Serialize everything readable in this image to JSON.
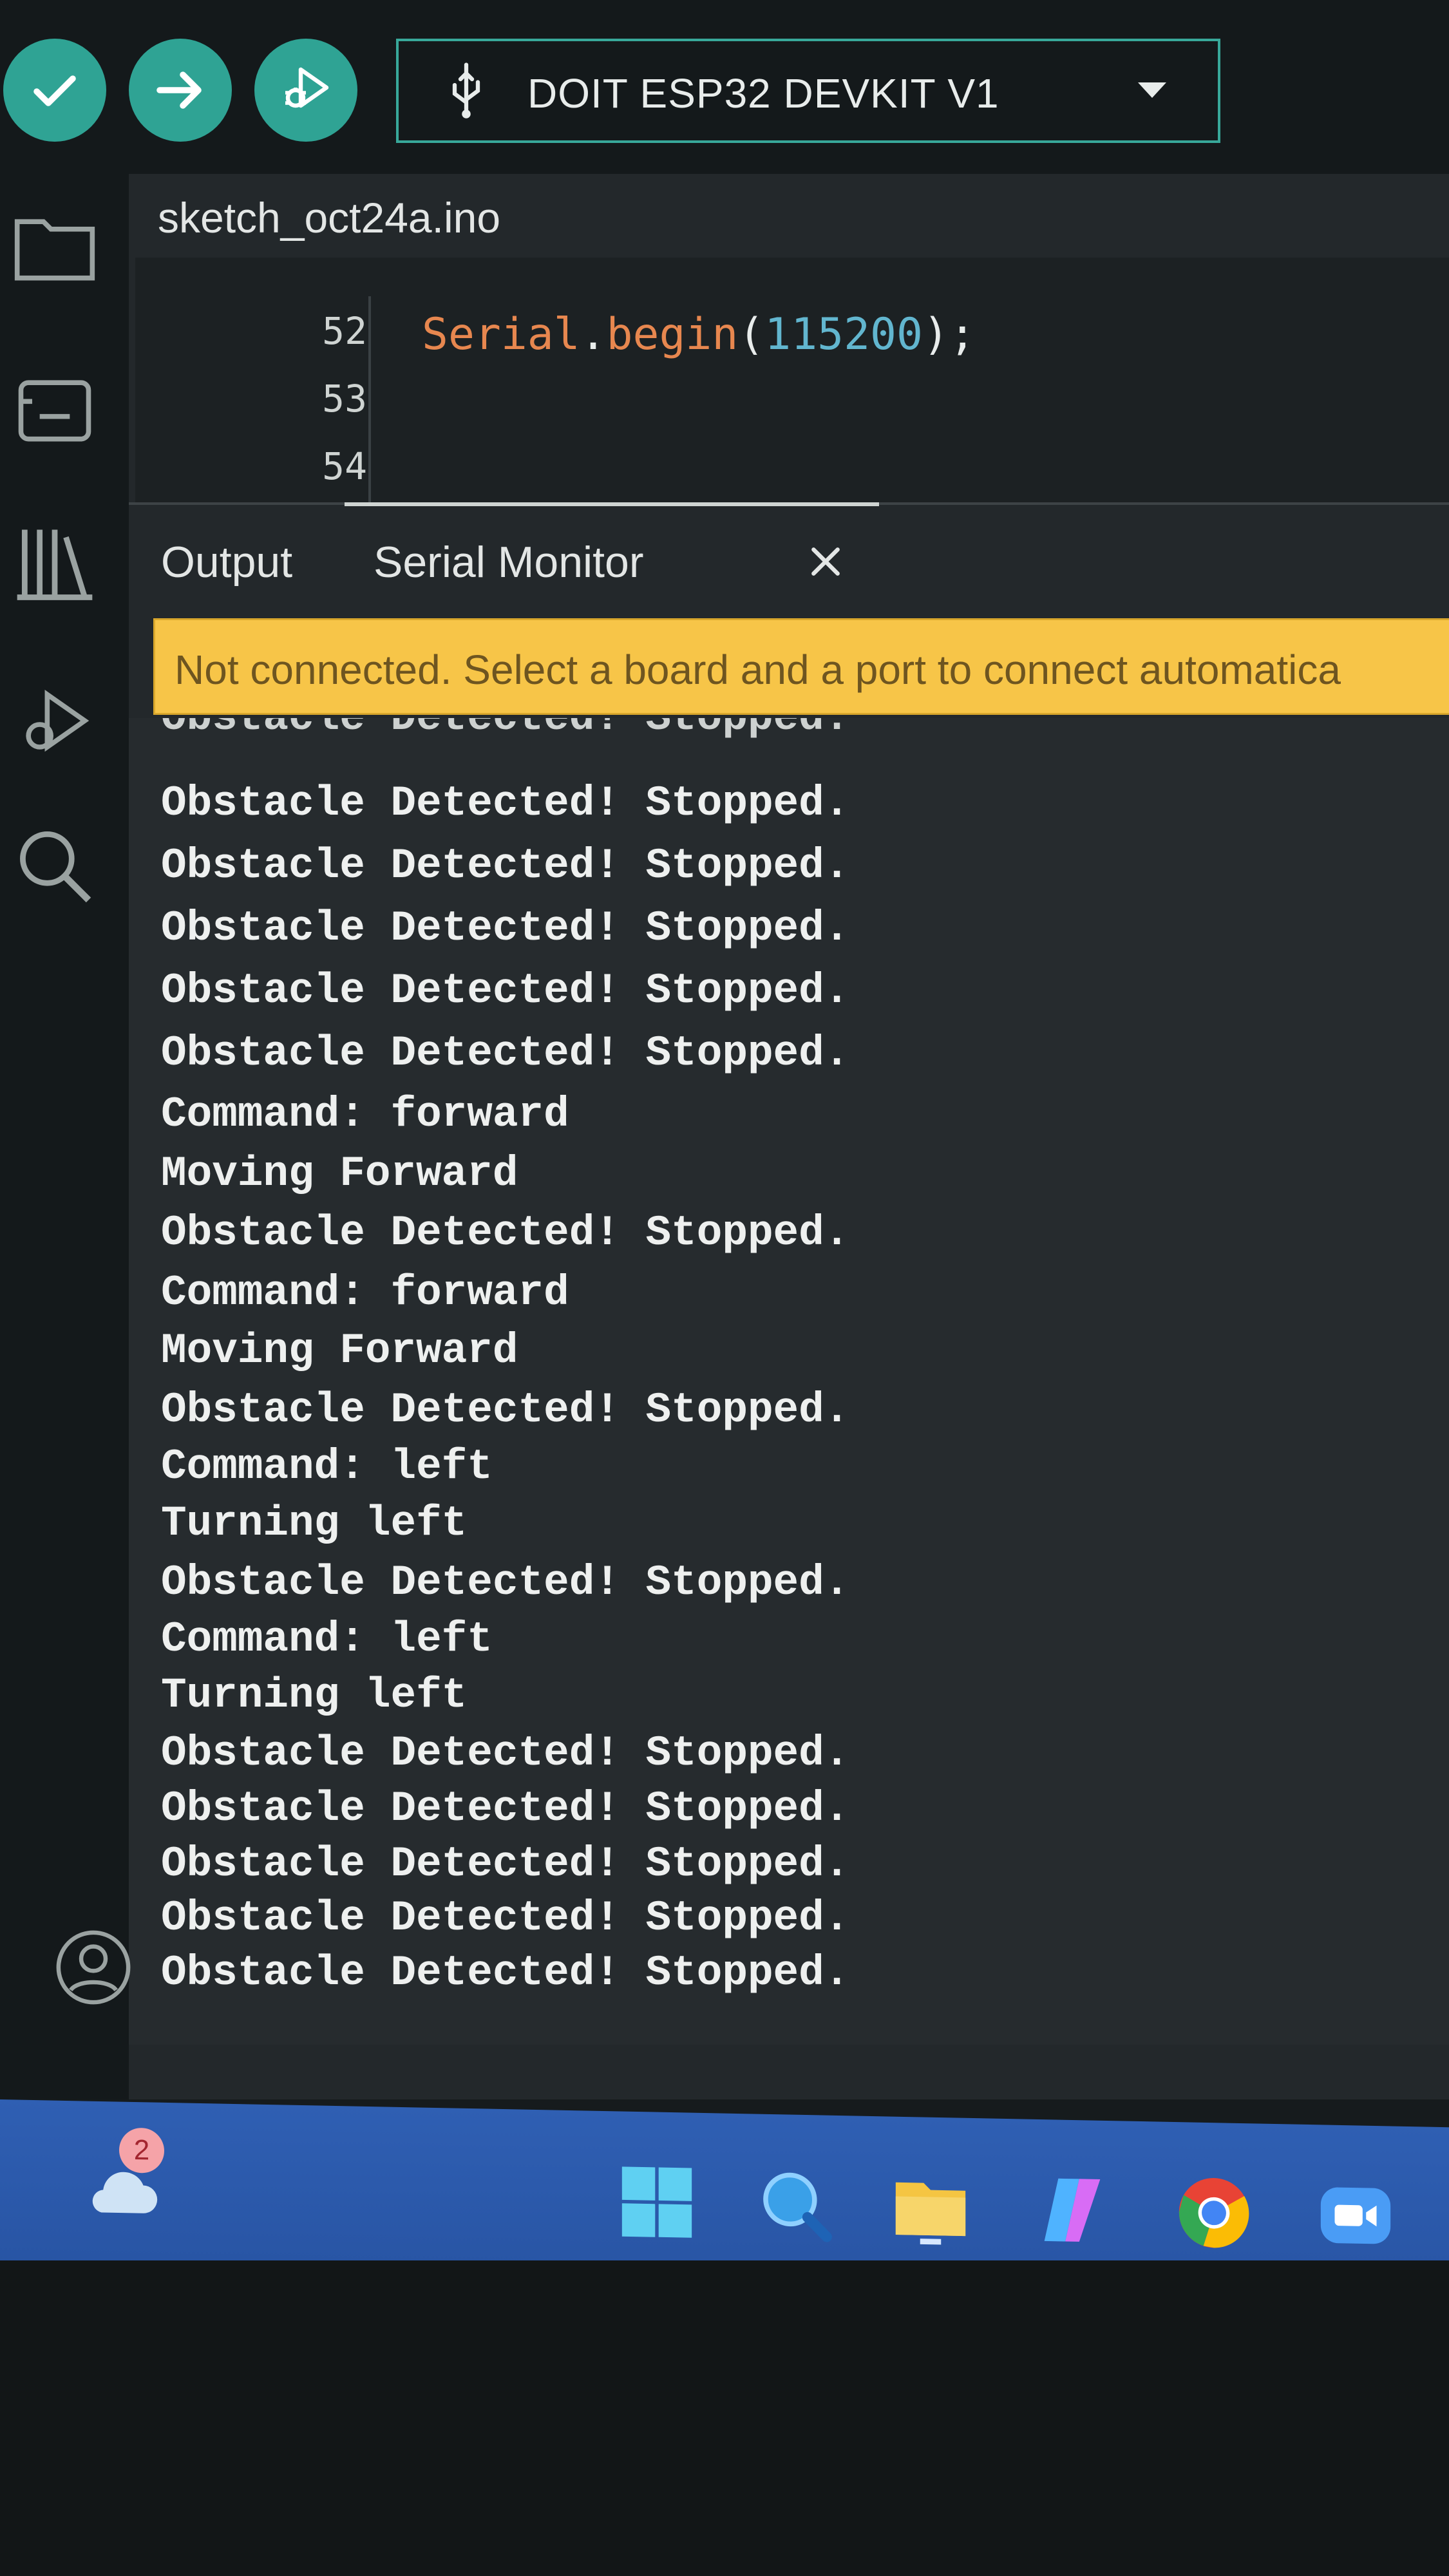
{
  "toolbar": {
    "verify_icon": "check-icon",
    "upload_icon": "arrow-right-icon",
    "debug_icon": "debug-icon",
    "board_name": "DOIT ESP32 DEVKIT V1",
    "accent": "#2fa394"
  },
  "sidebar": {
    "items": [
      "folder-icon",
      "board-manager-icon",
      "library-icon",
      "debug-icon",
      "search-icon",
      "account-icon"
    ]
  },
  "editor": {
    "file_tab": "sketch_oct24a.ino",
    "lines": [
      "52",
      "53",
      "54"
    ],
    "code_object": "Serial",
    "code_dot": ".",
    "code_method": "begin",
    "code_open": "(",
    "code_number": "115200",
    "code_close": ");"
  },
  "panel": {
    "tabs": [
      "Output",
      "Serial Monitor"
    ],
    "active_tab": "Serial Monitor"
  },
  "notification": {
    "text": "Not connected. Select a board and a port to connect automatica",
    "color": "#f7c548"
  },
  "serial_output": {
    "partial_top_line": "Obstacle Detected! Stopped.",
    "lines": [
      "Obstacle Detected! Stopped.",
      "Obstacle Detected! Stopped.",
      "Obstacle Detected! Stopped.",
      "Obstacle Detected! Stopped.",
      "Obstacle Detected! Stopped.",
      "Command: forward",
      "Moving Forward",
      "Obstacle Detected! Stopped.",
      "Command: forward",
      "Moving Forward",
      "Obstacle Detected! Stopped.",
      "Command: left",
      "Turning left",
      "Obstacle Detected! Stopped.",
      "Command: left",
      "Turning left",
      "Obstacle Detected! Stopped.",
      "Obstacle Detected! Stopped.",
      "Obstacle Detected! Stopped.",
      "Obstacle Detected! Stopped.",
      "Obstacle Detected! Stopped."
    ]
  },
  "taskbar": {
    "weather_badge": "2",
    "icons": [
      "weather-icon",
      "windows-start-icon",
      "search-icon",
      "file-explorer-icon",
      "copilot-icon",
      "chrome-icon",
      "zoom-icon"
    ]
  }
}
